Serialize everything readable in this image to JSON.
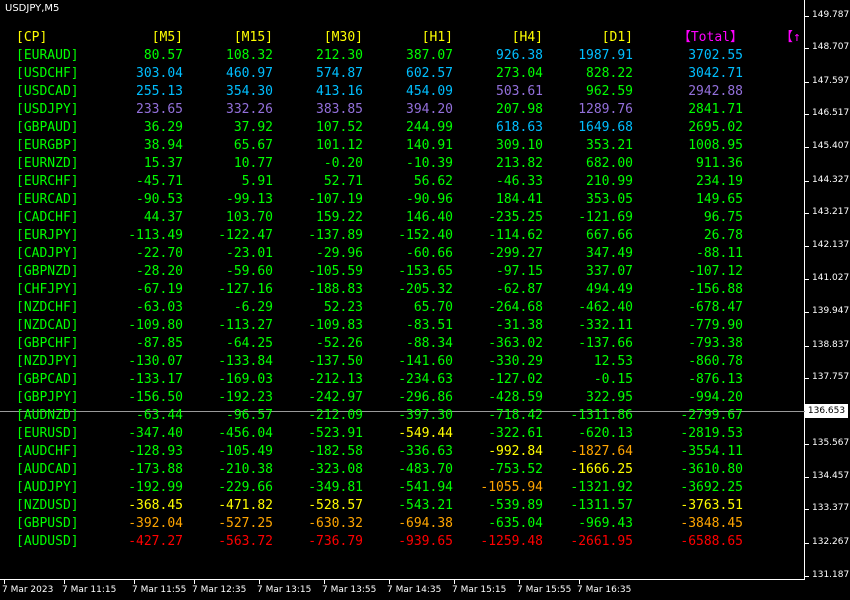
{
  "title": "USDJPY,M5",
  "current_price": "136.653",
  "price_axis": [
    "149.787",
    "148.707",
    "147.597",
    "146.517",
    "145.407",
    "144.327",
    "143.217",
    "142.137",
    "141.027",
    "139.947",
    "138.837",
    "137.757",
    "135.567",
    "134.457",
    "133.377",
    "132.267",
    "131.187"
  ],
  "time_axis": [
    "7 Mar 2023",
    "7 Mar 11:15",
    "7 Mar 11:55",
    "7 Mar 12:35",
    "7 Mar 13:15",
    "7 Mar 13:55",
    "7 Mar 14:35",
    "7 Mar 15:15",
    "7 Mar 15:55",
    "7 Mar 16:35"
  ],
  "colors": {
    "green": "#00ff00",
    "lime": "#66ff66",
    "cyan": "#00bfff",
    "skyblue": "#87cefa",
    "purple": "#9370db",
    "yellow": "#ffff00",
    "gold": "#ffd700",
    "orange": "#ffa500",
    "red": "#ff0000",
    "magenta": "#ff00ff",
    "header": "#ffff00"
  },
  "headers": [
    "[CP]",
    "[M5]",
    "[M15]",
    "[M30]",
    "[H1]",
    "[H4]",
    "[D1]",
    "【Total】",
    "【↑"
  ],
  "rows": [
    {
      "pair": "[EURAUD]",
      "values": [
        "80.57",
        "108.32",
        "212.30",
        "387.07",
        "926.38",
        "1987.91",
        "3702.55"
      ],
      "colors": [
        "green",
        "green",
        "green",
        "green",
        "cyan",
        "cyan",
        "cyan"
      ]
    },
    {
      "pair": "[USDCHF]",
      "values": [
        "303.04",
        "460.97",
        "574.87",
        "602.57",
        "273.04",
        "828.22",
        "3042.71"
      ],
      "colors": [
        "cyan",
        "cyan",
        "cyan",
        "cyan",
        "green",
        "green",
        "cyan"
      ]
    },
    {
      "pair": "[USDCAD]",
      "values": [
        "255.13",
        "354.30",
        "413.16",
        "454.09",
        "503.61",
        "962.59",
        "2942.88"
      ],
      "colors": [
        "cyan",
        "cyan",
        "cyan",
        "cyan",
        "purple",
        "green",
        "purple"
      ]
    },
    {
      "pair": "[USDJPY]",
      "values": [
        "233.65",
        "332.26",
        "383.85",
        "394.20",
        "207.98",
        "1289.76",
        "2841.71"
      ],
      "colors": [
        "purple",
        "purple",
        "purple",
        "purple",
        "green",
        "purple",
        "green"
      ]
    },
    {
      "pair": "[GBPAUD]",
      "values": [
        "36.29",
        "37.92",
        "107.52",
        "244.99",
        "618.63",
        "1649.68",
        "2695.02"
      ],
      "colors": [
        "green",
        "green",
        "green",
        "green",
        "cyan",
        "cyan",
        "green"
      ]
    },
    {
      "pair": "[EURGBP]",
      "values": [
        "38.94",
        "65.67",
        "101.12",
        "140.91",
        "309.10",
        "353.21",
        "1008.95"
      ],
      "colors": [
        "green",
        "green",
        "green",
        "green",
        "green",
        "green",
        "green"
      ]
    },
    {
      "pair": "[EURNZD]",
      "values": [
        "15.37",
        "10.77",
        "-0.20",
        "-10.39",
        "213.82",
        "682.00",
        "911.36"
      ],
      "colors": [
        "green",
        "green",
        "green",
        "green",
        "green",
        "green",
        "green"
      ]
    },
    {
      "pair": "[EURCHF]",
      "values": [
        "-45.71",
        "5.91",
        "52.71",
        "56.62",
        "-46.33",
        "210.99",
        "234.19"
      ],
      "colors": [
        "green",
        "green",
        "green",
        "green",
        "green",
        "green",
        "green"
      ]
    },
    {
      "pair": "[EURCAD]",
      "values": [
        "-90.53",
        "-99.13",
        "-107.19",
        "-90.96",
        "184.41",
        "353.05",
        "149.65"
      ],
      "colors": [
        "green",
        "green",
        "green",
        "green",
        "green",
        "green",
        "green"
      ]
    },
    {
      "pair": "[CADCHF]",
      "values": [
        "44.37",
        "103.70",
        "159.22",
        "146.40",
        "-235.25",
        "-121.69",
        "96.75"
      ],
      "colors": [
        "green",
        "green",
        "green",
        "green",
        "green",
        "green",
        "green"
      ]
    },
    {
      "pair": "[EURJPY]",
      "values": [
        "-113.49",
        "-122.47",
        "-137.89",
        "-152.40",
        "-114.62",
        "667.66",
        "26.78"
      ],
      "colors": [
        "green",
        "green",
        "green",
        "green",
        "green",
        "green",
        "green"
      ]
    },
    {
      "pair": "[CADJPY]",
      "values": [
        "-22.70",
        "-23.01",
        "-29.96",
        "-60.66",
        "-299.27",
        "347.49",
        "-88.11"
      ],
      "colors": [
        "green",
        "green",
        "green",
        "green",
        "green",
        "green",
        "green"
      ]
    },
    {
      "pair": "[GBPNZD]",
      "values": [
        "-28.20",
        "-59.60",
        "-105.59",
        "-153.65",
        "-97.15",
        "337.07",
        "-107.12"
      ],
      "colors": [
        "green",
        "green",
        "green",
        "green",
        "green",
        "green",
        "green"
      ]
    },
    {
      "pair": "[CHFJPY]",
      "values": [
        "-67.19",
        "-127.16",
        "-188.83",
        "-205.32",
        "-62.87",
        "494.49",
        "-156.88"
      ],
      "colors": [
        "green",
        "green",
        "green",
        "green",
        "green",
        "green",
        "green"
      ]
    },
    {
      "pair": "[NZDCHF]",
      "values": [
        "-63.03",
        "-6.29",
        "52.23",
        "65.70",
        "-264.68",
        "-462.40",
        "-678.47"
      ],
      "colors": [
        "green",
        "green",
        "green",
        "green",
        "green",
        "green",
        "green"
      ]
    },
    {
      "pair": "[NZDCAD]",
      "values": [
        "-109.80",
        "-113.27",
        "-109.83",
        "-83.51",
        "-31.38",
        "-332.11",
        "-779.90"
      ],
      "colors": [
        "green",
        "green",
        "green",
        "green",
        "green",
        "green",
        "green"
      ]
    },
    {
      "pair": "[GBPCHF]",
      "values": [
        "-87.85",
        "-64.25",
        "-52.26",
        "-88.34",
        "-363.02",
        "-137.66",
        "-793.38"
      ],
      "colors": [
        "green",
        "green",
        "green",
        "green",
        "green",
        "green",
        "green"
      ]
    },
    {
      "pair": "[NZDJPY]",
      "values": [
        "-130.07",
        "-133.84",
        "-137.50",
        "-141.60",
        "-330.29",
        "12.53",
        "-860.78"
      ],
      "colors": [
        "green",
        "green",
        "green",
        "green",
        "green",
        "green",
        "green"
      ]
    },
    {
      "pair": "[GBPCAD]",
      "values": [
        "-133.17",
        "-169.03",
        "-212.13",
        "-234.63",
        "-127.02",
        "-0.15",
        "-876.13"
      ],
      "colors": [
        "green",
        "green",
        "green",
        "green",
        "green",
        "green",
        "green"
      ]
    },
    {
      "pair": "[GBPJPY]",
      "values": [
        "-156.50",
        "-192.23",
        "-242.97",
        "-296.86",
        "-428.59",
        "322.95",
        "-994.20"
      ],
      "colors": [
        "green",
        "green",
        "green",
        "green",
        "green",
        "green",
        "green"
      ]
    },
    {
      "pair": "[AUDNZD]",
      "values": [
        "-63.44",
        "-96.57",
        "-212.09",
        "-397.30",
        "-718.42",
        "-1311.86",
        "-2799.67"
      ],
      "colors": [
        "green",
        "green",
        "green",
        "green",
        "green",
        "green",
        "green"
      ]
    },
    {
      "pair": "[EURUSD]",
      "values": [
        "-347.40",
        "-456.04",
        "-523.91",
        "-549.44",
        "-322.61",
        "-620.13",
        "-2819.53"
      ],
      "colors": [
        "green",
        "green",
        "green",
        "yellow",
        "green",
        "green",
        "green"
      ]
    },
    {
      "pair": "[AUDCHF]",
      "values": [
        "-128.93",
        "-105.49",
        "-182.58",
        "-336.63",
        "-992.84",
        "-1827.64",
        "-3554.11"
      ],
      "colors": [
        "green",
        "green",
        "green",
        "green",
        "yellow",
        "orange",
        "green"
      ]
    },
    {
      "pair": "[AUDCAD]",
      "values": [
        "-173.88",
        "-210.38",
        "-323.08",
        "-483.70",
        "-753.52",
        "-1666.25",
        "-3610.80"
      ],
      "colors": [
        "green",
        "green",
        "green",
        "green",
        "green",
        "yellow",
        "green"
      ]
    },
    {
      "pair": "[AUDJPY]",
      "values": [
        "-192.99",
        "-229.66",
        "-349.81",
        "-541.94",
        "-1055.94",
        "-1321.92",
        "-3692.25"
      ],
      "colors": [
        "green",
        "green",
        "green",
        "green",
        "orange",
        "green",
        "green"
      ]
    },
    {
      "pair": "[NZDUSD]",
      "values": [
        "-368.45",
        "-471.82",
        "-528.57",
        "-543.21",
        "-539.89",
        "-1311.57",
        "-3763.51"
      ],
      "colors": [
        "yellow",
        "yellow",
        "yellow",
        "green",
        "green",
        "green",
        "yellow"
      ]
    },
    {
      "pair": "[GBPUSD]",
      "values": [
        "-392.04",
        "-527.25",
        "-630.32",
        "-694.38",
        "-635.04",
        "-969.43",
        "-3848.45"
      ],
      "colors": [
        "orange",
        "orange",
        "orange",
        "orange",
        "green",
        "green",
        "orange"
      ]
    },
    {
      "pair": "[AUDUSD]",
      "values": [
        "-427.27",
        "-563.72",
        "-736.79",
        "-939.65",
        "-1259.48",
        "-2661.95",
        "-6588.65"
      ],
      "colors": [
        "red",
        "red",
        "red",
        "red",
        "red",
        "red",
        "red"
      ]
    }
  ]
}
